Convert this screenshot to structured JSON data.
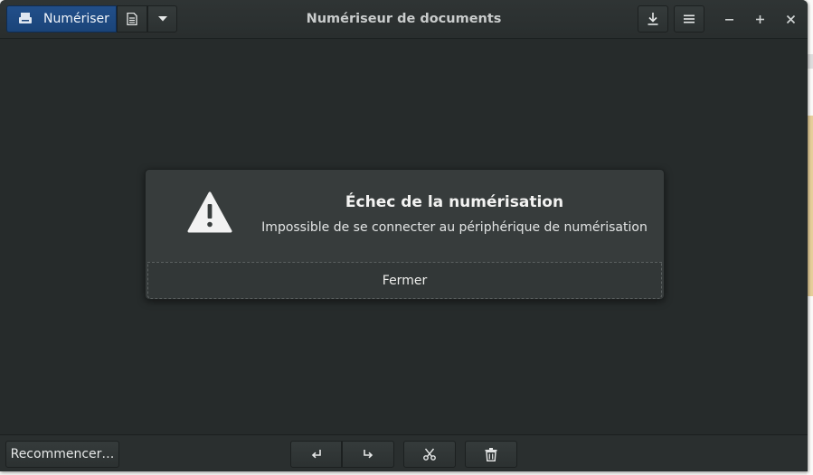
{
  "window": {
    "title": "Numériseur de documents"
  },
  "header": {
    "scan_label": "Numériser",
    "icons": {
      "scan": "scanner-icon",
      "document": "document-icon",
      "dropdown": "chevron-down-icon",
      "save": "download-icon",
      "menu": "hamburger-menu-icon",
      "minimize": "minimize-icon",
      "maximize": "maximize-icon",
      "close": "close-icon"
    }
  },
  "dialog": {
    "title": "Échec de la numérisation",
    "message": "Impossible de se connecter au périphérique de numérisation",
    "close_label": "Fermer",
    "icon": "warning-icon"
  },
  "footer": {
    "restart_label": "Recommencer…",
    "icons": {
      "rotate_left": "rotate-left-icon",
      "rotate_right": "rotate-right-icon",
      "crop": "scissors-icon",
      "delete": "trash-icon"
    }
  },
  "colors": {
    "accent": "#1a4479",
    "window_bg": "#262b2b",
    "dialog_bg": "#373c3c"
  }
}
